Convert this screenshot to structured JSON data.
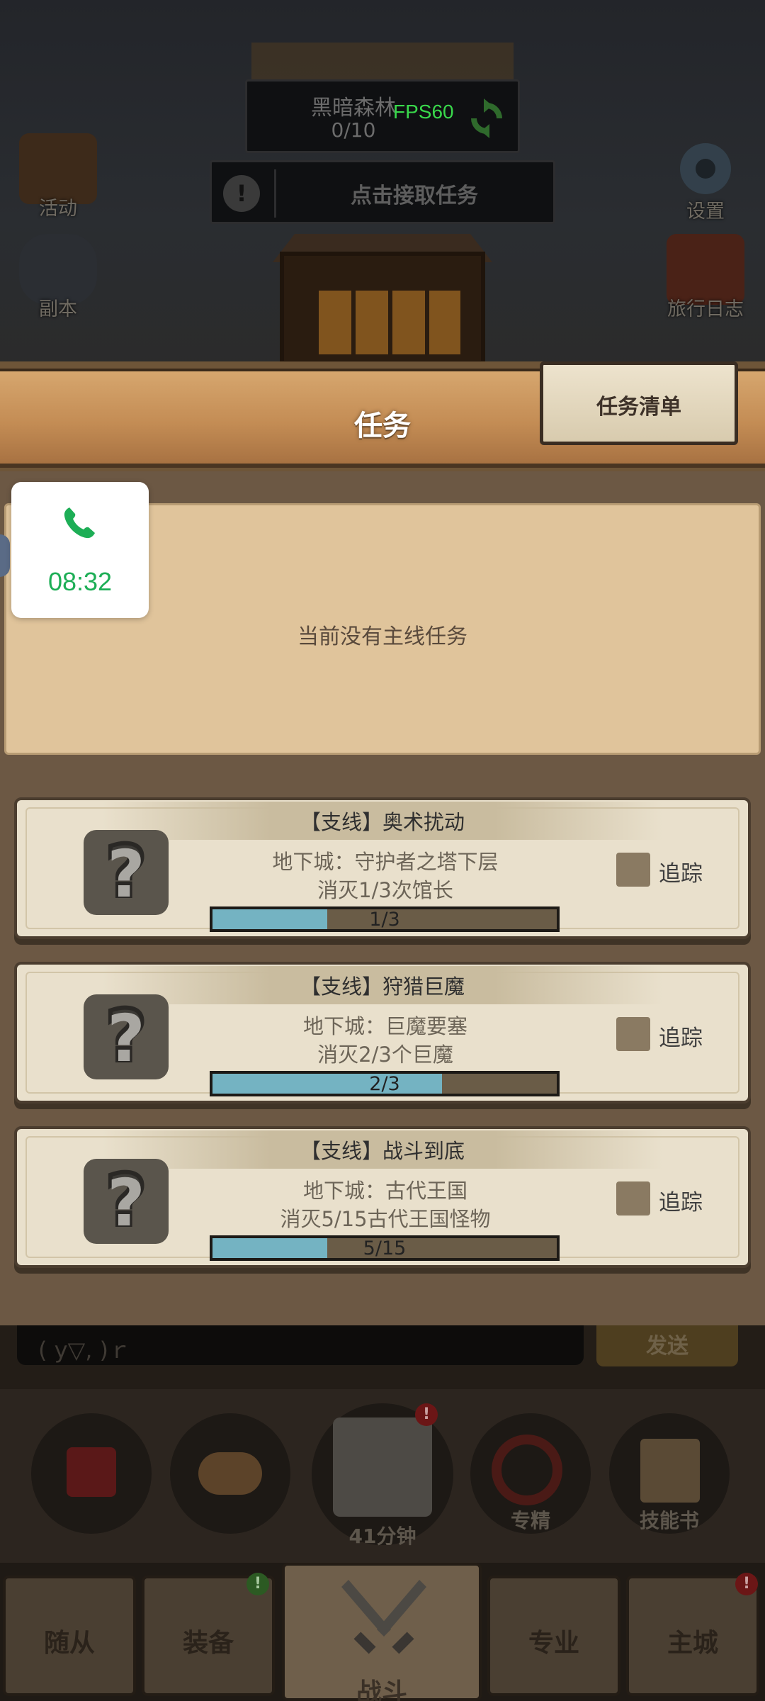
{
  "hud": {
    "location_name": "黑暗森林",
    "location_progress": "0/10",
    "fps": "FPS60",
    "quest_prompt": "点击接取任务",
    "quest_prompt_badge": "!"
  },
  "side_buttons": {
    "activity": "活动",
    "dungeon": "副本",
    "settings": "设置",
    "travel_log": "旅行日志"
  },
  "modal": {
    "title": "任务",
    "list_button": "任务清单",
    "main_empty_text": "当前没有主线任务"
  },
  "quests": [
    {
      "title": "【支线】奥术扰动",
      "location": "地下城：守护者之塔下层",
      "objective": "消灭1/3次馆长",
      "progress_text": "1/3",
      "progress": 0.333,
      "track_label": "追踪"
    },
    {
      "title": "【支线】狩猎巨魔",
      "location": "地下城：巨魔要塞",
      "objective": "消灭2/3个巨魔",
      "progress_text": "2/3",
      "progress": 0.667,
      "track_label": "追踪"
    },
    {
      "title": "【支线】战斗到底",
      "location": "地下城：古代王国",
      "objective": "消灭5/15古代王国怪物",
      "progress_text": "5/15",
      "progress": 0.333,
      "track_label": "追踪"
    }
  ],
  "call_overlay": {
    "time": "08:32"
  },
  "chat": {
    "input_text": "( y▽, )ｒ",
    "send_label": "发送"
  },
  "actions": {
    "chest_timer": "41分钟",
    "specialization": "专精",
    "skill_book": "技能书",
    "alert_mark": "!"
  },
  "tabs": {
    "followers": "随从",
    "equipment": "装备",
    "battle": "战斗",
    "profession": "专业",
    "main_city": "主城"
  },
  "colors": {
    "progress_fill": "#74b3c2",
    "fps_green": "#39d84b",
    "call_green": "#1dae56"
  }
}
